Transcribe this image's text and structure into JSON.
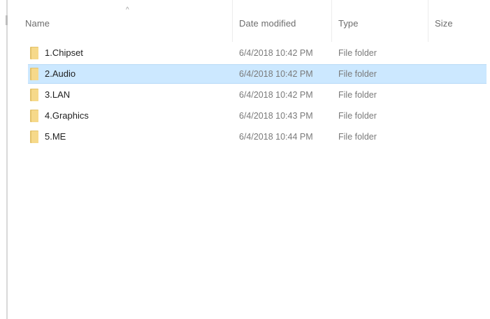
{
  "columns": {
    "name": "Name",
    "date_modified": "Date modified",
    "type": "Type",
    "size": "Size"
  },
  "sort_indicator": "^",
  "selected_index": 1,
  "rows": [
    {
      "name": "1.Chipset",
      "date": "6/4/2018 10:42 PM",
      "type": "File folder",
      "size": ""
    },
    {
      "name": "2.Audio",
      "date": "6/4/2018 10:42 PM",
      "type": "File folder",
      "size": ""
    },
    {
      "name": "3.LAN",
      "date": "6/4/2018 10:42 PM",
      "type": "File folder",
      "size": ""
    },
    {
      "name": "4.Graphics",
      "date": "6/4/2018 10:43 PM",
      "type": "File folder",
      "size": ""
    },
    {
      "name": "5.ME",
      "date": "6/4/2018 10:44 PM",
      "type": "File folder",
      "size": ""
    }
  ],
  "colors": {
    "selection": "#cce8ff",
    "folder": "#f6d98a"
  },
  "icons": {
    "row_icon": "folder-icon"
  }
}
